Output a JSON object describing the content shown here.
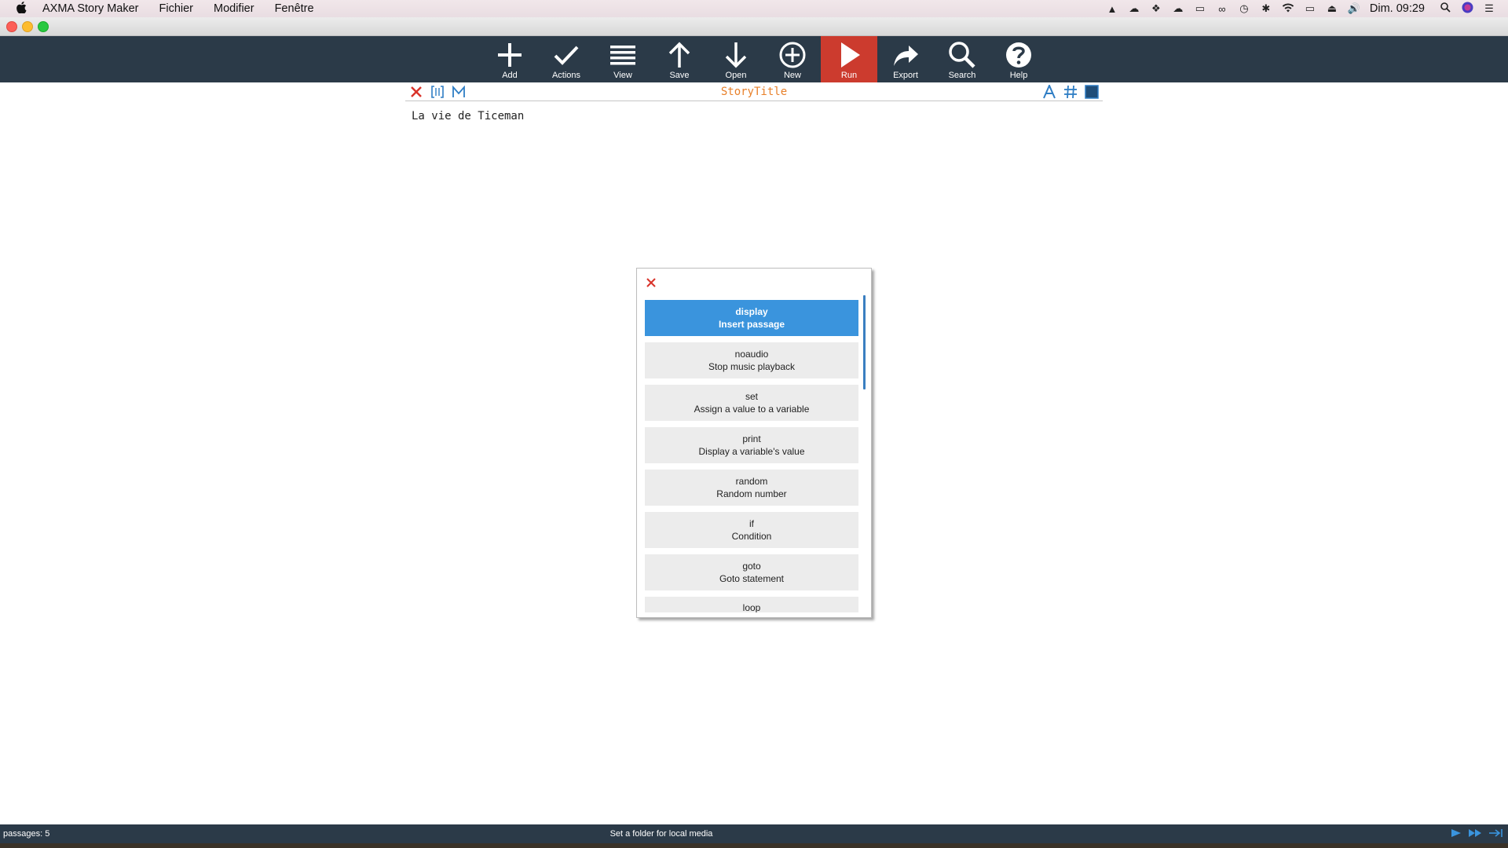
{
  "menubar": {
    "app_name": "AXMA Story Maker",
    "items": [
      "Fichier",
      "Modifier",
      "Fenêtre"
    ],
    "clock": "Dim. 09:29"
  },
  "toolbar": {
    "items": [
      {
        "label": "Add",
        "icon": "plus-icon"
      },
      {
        "label": "Actions",
        "icon": "check-icon"
      },
      {
        "label": "View",
        "icon": "menu-icon"
      },
      {
        "label": "Save",
        "icon": "arrow-up-icon"
      },
      {
        "label": "Open",
        "icon": "arrow-down-icon"
      },
      {
        "label": "New",
        "icon": "plus-circle-icon"
      },
      {
        "label": "Run",
        "icon": "play-icon"
      },
      {
        "label": "Export",
        "icon": "share-icon"
      },
      {
        "label": "Search",
        "icon": "search-icon"
      },
      {
        "label": "Help",
        "icon": "help-icon"
      }
    ],
    "active": "Run",
    "active_color": "#cc3b2e",
    "background": "#2b3a48"
  },
  "editor": {
    "story_title": "StoryTitle",
    "content": "La vie de Ticeman",
    "title_color": "#e8802a"
  },
  "popup": {
    "items": [
      {
        "name": "display",
        "desc": "Insert passage",
        "selected": true
      },
      {
        "name": "noaudio",
        "desc": "Stop music playback"
      },
      {
        "name": "set",
        "desc": "Assign a value to a variable"
      },
      {
        "name": "print",
        "desc": "Display a variable's value"
      },
      {
        "name": "random",
        "desc": "Random number"
      },
      {
        "name": "if",
        "desc": "Condition"
      },
      {
        "name": "goto",
        "desc": "Goto statement"
      },
      {
        "name": "loop",
        "desc": ""
      }
    ],
    "selected_color": "#3a94dd"
  },
  "statusbar": {
    "passages": "passages: 5",
    "folder_text": "Set a folder for local media"
  }
}
